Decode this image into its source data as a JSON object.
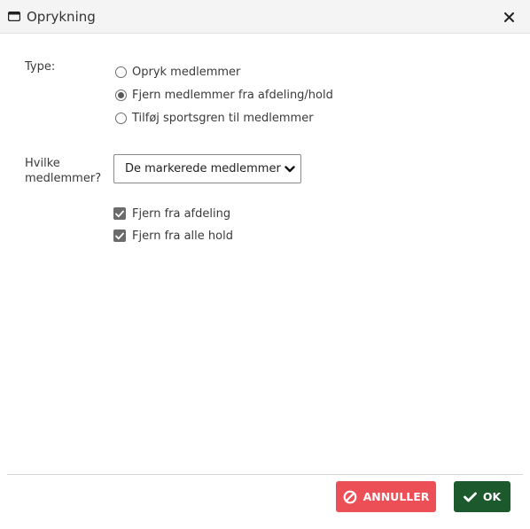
{
  "dialog": {
    "title": "Oprykning",
    "icons": {
      "window": "window-icon",
      "close": "close-icon"
    }
  },
  "form": {
    "type_label": "Type:",
    "type_options": [
      {
        "label": "Opryk medlemmer",
        "checked": false
      },
      {
        "label": "Fjern medlemmer fra afdeling/hold",
        "checked": true
      },
      {
        "label": "Tilføj sportsgren til medlemmer",
        "checked": false
      }
    ],
    "members_label_line1": "Hvilke",
    "members_label_line2": "medlemmer?",
    "members_select": {
      "value": "De markerede medlemmer"
    },
    "checkboxes": [
      {
        "label": "Fjern fra afdeling",
        "checked": true
      },
      {
        "label": "Fjern fra alle hold",
        "checked": true
      }
    ]
  },
  "footer": {
    "cancel_label": "ANNULLER",
    "ok_label": "OK",
    "colors": {
      "cancel": "#ec4f55",
      "ok": "#1c5a2e"
    }
  }
}
